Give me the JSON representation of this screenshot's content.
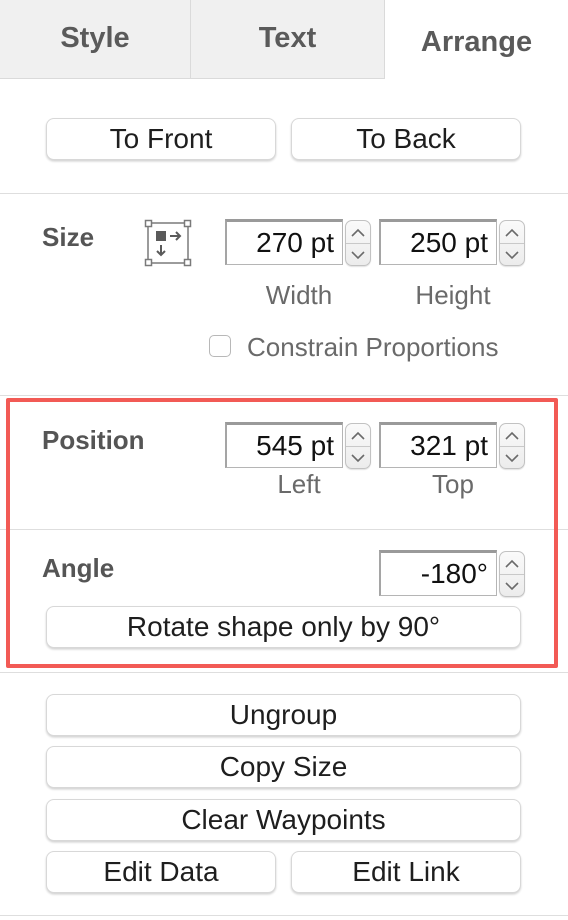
{
  "tabs": [
    {
      "label": "Style"
    },
    {
      "label": "Text"
    },
    {
      "label": "Arrange"
    }
  ],
  "order": {
    "to_front": "To Front",
    "to_back": "To Back"
  },
  "size": {
    "label": "Size",
    "width_value": "270 pt",
    "height_value": "250 pt",
    "width_label": "Width",
    "height_label": "Height",
    "constrain_label": "Constrain Proportions",
    "constrain_checked": false
  },
  "position": {
    "label": "Position",
    "left_value": "545 pt",
    "top_value": "321 pt",
    "left_label": "Left",
    "top_label": "Top"
  },
  "angle": {
    "label": "Angle",
    "value": "-180°",
    "rotate_button": "Rotate shape only by 90°"
  },
  "actions": {
    "ungroup": "Ungroup",
    "copy_size": "Copy Size",
    "clear_waypoints": "Clear Waypoints",
    "edit_data": "Edit Data",
    "edit_link": "Edit Link"
  },
  "colors": {
    "highlight": "#f25a55"
  }
}
